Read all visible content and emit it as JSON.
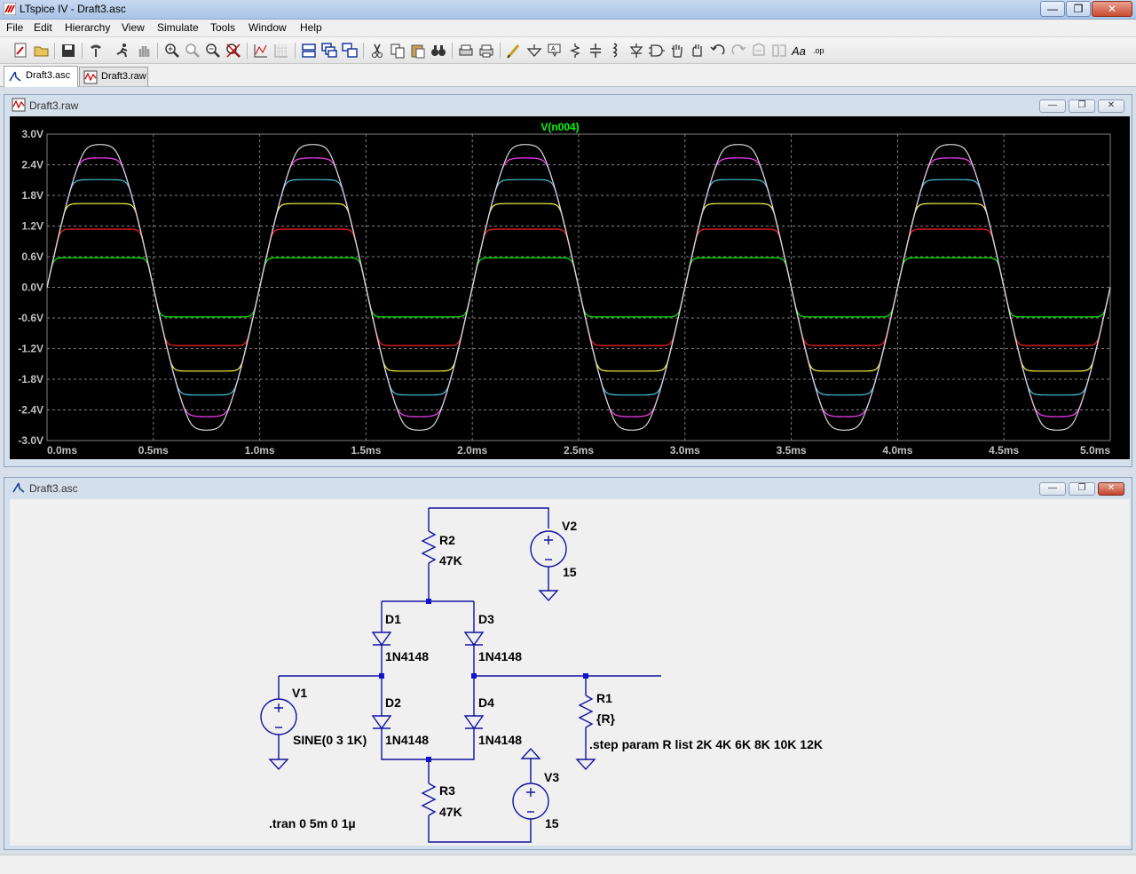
{
  "app": {
    "title": "LTspice IV - Draft3.asc",
    "minimize": "—",
    "restore": "❐",
    "close": "✕"
  },
  "menu": [
    "File",
    "Edit",
    "Hierarchy",
    "View",
    "Simulate",
    "Tools",
    "Window",
    "Help"
  ],
  "toolbar_icons": [
    "new-schematic-icon",
    "open-icon",
    "save-icon",
    "control-panel-icon",
    "run-icon",
    "halt-icon",
    "zoom-in-icon",
    "zoom-pan-icon",
    "zoom-out-icon",
    "zoom-fit-icon",
    "autorange-icon",
    "grid-icon",
    "tile-horizontal-icon",
    "cascade-icon",
    "tile-vertical-icon",
    "cut-icon",
    "copy-icon",
    "paste-icon",
    "find-icon",
    "print-setup-icon",
    "print-icon",
    "draw-wire-icon",
    "ground-icon",
    "label-net-icon",
    "resistor-icon",
    "capacitor-icon",
    "inductor-icon",
    "diode-icon",
    "component-icon",
    "move-icon",
    "drag-icon",
    "undo-icon",
    "redo-icon",
    "rotate-icon",
    "mirror-icon",
    "text-icon",
    "spice-directive-icon"
  ],
  "tabs": [
    {
      "label": "Draft3.asc",
      "icon": "schematic-icon"
    },
    {
      "label": "Draft3.raw",
      "icon": "waveform-icon"
    }
  ],
  "waveform_window": {
    "title": "Draft3.raw",
    "colors": {
      "background": "#000000",
      "grid": "#7f7f7f",
      "axis_text": "#c0c0c0",
      "trace_label": "#00ff00"
    }
  },
  "chart_data": {
    "type": "line",
    "title": "V(n004)",
    "xlabel": "",
    "ylabel": "",
    "xlim": [
      0,
      5
    ],
    "ylim": [
      -3.0,
      3.0
    ],
    "x_ticks": [
      "0.0ms",
      "0.5ms",
      "1.0ms",
      "1.5ms",
      "2.0ms",
      "2.5ms",
      "3.0ms",
      "3.5ms",
      "4.0ms",
      "4.5ms",
      "5.0ms"
    ],
    "y_ticks": [
      "3.0V",
      "2.4V",
      "1.8V",
      "1.2V",
      "0.6V",
      "0.0V",
      "-0.6V",
      "-1.2V",
      "-1.8V",
      "-2.4V",
      "-3.0V"
    ],
    "grid": true,
    "source_amplitude": 3.0,
    "frequency_khz": 1,
    "series": [
      {
        "step": "R=2K",
        "color": "#00ff00",
        "clip": 0.58
      },
      {
        "step": "R=4K",
        "color": "#ff2020",
        "clip": 1.14
      },
      {
        "step": "R=6K",
        "color": "#ffff40",
        "clip": 1.64
      },
      {
        "step": "R=8K",
        "color": "#40c8e0",
        "clip": 2.11
      },
      {
        "step": "R=10K",
        "color": "#ff40ff",
        "clip": 2.54
      },
      {
        "step": "R=12K",
        "color": "#d8d8d8",
        "clip": 2.83
      }
    ]
  },
  "schematic_window": {
    "title": "Draft3.asc",
    "colors": {
      "wire": "#1212a0",
      "text": "#000000",
      "junction": "#1212d0"
    },
    "components": {
      "R2": {
        "name": "R2",
        "value": "47K"
      },
      "R3": {
        "name": "R3",
        "value": "47K"
      },
      "R1": {
        "name": "R1",
        "value": "{R}"
      },
      "V1": {
        "name": "V1",
        "value": "SINE(0 3 1K)"
      },
      "V2": {
        "name": "V2",
        "value": "15"
      },
      "V3": {
        "name": "V3",
        "value": "15"
      },
      "D1": {
        "name": "D1",
        "value": "1N4148"
      },
      "D2": {
        "name": "D2",
        "value": "1N4148"
      },
      "D3": {
        "name": "D3",
        "value": "1N4148"
      },
      "D4": {
        "name": "D4",
        "value": "1N4148"
      }
    },
    "directives": {
      "tran": ".tran 0 5m 0 1µ",
      "step": ".step param R list 2K 4K 6K 8K 10K 12K"
    }
  }
}
